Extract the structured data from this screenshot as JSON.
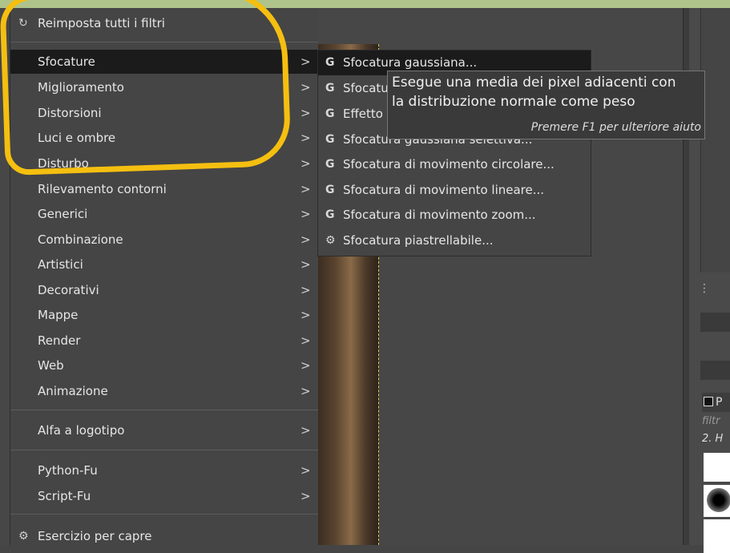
{
  "menu": {
    "reset_label": "Reimposta tutti i filtri",
    "items": [
      {
        "label": "Sfocature",
        "active": true
      },
      {
        "label": "Miglioramento"
      },
      {
        "label": "Distorsioni"
      },
      {
        "label": "Luci e ombre"
      },
      {
        "label": "Disturbo"
      },
      {
        "label": "Rilevamento contorni"
      },
      {
        "label": "Generici"
      },
      {
        "label": "Combinazione"
      },
      {
        "label": "Artistici"
      },
      {
        "label": "Decorativi"
      },
      {
        "label": "Mappe"
      },
      {
        "label": "Render"
      },
      {
        "label": "Web"
      },
      {
        "label": "Animazione"
      }
    ],
    "alpha_label": "Alfa a logotipo",
    "python_label": "Python-Fu",
    "script_label": "Script-Fu",
    "goat_label": "Esercizio per capre",
    "arrow": ">"
  },
  "submenu": {
    "items": [
      {
        "label": "Sfocatura gaussiana...",
        "icon": "G"
      },
      {
        "label": "Sfocatu",
        "icon": "G"
      },
      {
        "label": "Effetto",
        "icon": "G"
      },
      {
        "label": "Sfocatura gaussiana selettiva...",
        "icon": "G"
      },
      {
        "label": "Sfocatura di movimento circolare...",
        "icon": "G"
      },
      {
        "label": "Sfocatura di movimento lineare...",
        "icon": "G"
      },
      {
        "label": "Sfocatura di movimento zoom...",
        "icon": "G"
      },
      {
        "label": "Sfocatura piastrellabile...",
        "icon": "plugin-icon"
      }
    ]
  },
  "tooltip": {
    "line1": "Esegue una media dei pixel adiacenti con",
    "line2": "la distribuzione normale come peso",
    "help": "Premere F1 per ulteriore aiuto"
  },
  "dock": {
    "tab_label": "P",
    "filter_placeholder": "filtr",
    "brush_name": "2. H"
  },
  "colors": {
    "annotation": "#f5bf10",
    "menu_bg": "#454545",
    "highlight": "#1b1b1b"
  }
}
